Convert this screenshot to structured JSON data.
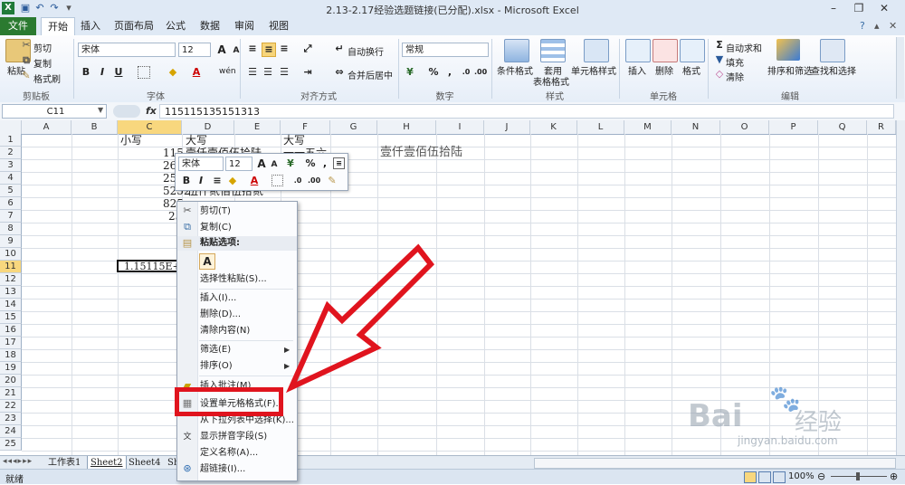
{
  "titlebar": {
    "title": "2.13-2.17经验选题链接(已分配).xlsx - Microsoft Excel",
    "window_buttons": [
      "–",
      "❐",
      "✕"
    ]
  },
  "tabs": [
    "文件",
    "开始",
    "插入",
    "页面布局",
    "公式",
    "数据",
    "审阅",
    "视图"
  ],
  "ribbon": {
    "clipboard": {
      "paste": "粘贴",
      "cut": "剪切",
      "copy": "复制",
      "format_painter": "格式刷",
      "label": "剪贴板"
    },
    "font": {
      "name": "宋体",
      "size": "12",
      "grow": "A",
      "shrink": "A",
      "bold": "B",
      "italic": "I",
      "underline": "U",
      "wen": "wén",
      "label": "字体"
    },
    "alignment": {
      "wrap": "自动换行",
      "merge": "合并后居中",
      "label": "对齐方式"
    },
    "number": {
      "format": "常规",
      "percent": "%",
      "comma": ",",
      "label": "数字"
    },
    "styles": {
      "conditional": "条件格式",
      "table_1": "套用",
      "table_2": "表格格式",
      "cell_styles": "单元格样式",
      "label": "样式"
    },
    "cells": {
      "insert": "插入",
      "delete": "删除",
      "format": "格式",
      "label": "单元格"
    },
    "editing": {
      "autosum": "自动求和",
      "fill": "填充",
      "clear": "清除",
      "sort": "排序和筛选",
      "find": "查找和选择",
      "label": "编辑"
    }
  },
  "formula_bar": {
    "name_box": "C11",
    "fx": "fx",
    "content": "115115135151313"
  },
  "grid": {
    "columns": [
      "A",
      "B",
      "C",
      "D",
      "E",
      "F",
      "G",
      "H",
      "I",
      "J",
      "K",
      "L",
      "M",
      "N",
      "O",
      "P",
      "Q",
      "R"
    ],
    "rows": [
      "1",
      "2",
      "3",
      "4",
      "5",
      "6",
      "7",
      "8",
      "9",
      "10",
      "11",
      "12",
      "13",
      "14",
      "15",
      "16",
      "17",
      "18",
      "19",
      "20",
      "21",
      "22",
      "23",
      "24",
      "25"
    ],
    "selected_column": "C",
    "selected_row": "11",
    "cells": {
      "c1": "小写",
      "d1": "大写",
      "f1": "大写",
      "c2": "115",
      "d2": "壹仟壹佰伍拾陆",
      "f2": "一一五六",
      "c3": "264",
      "c4": "252",
      "c5": "5252",
      "d5": "伍仟贰佰伍拾贰",
      "c6": "825",
      "c7": "25",
      "h2": "壹仟壹佰伍拾陆",
      "c11": "1.15115E+1"
    }
  },
  "mini_toolbar": {
    "font": "宋体",
    "size": "12",
    "grow": "A",
    "shrink": "A",
    "percent": "%",
    "comma": ",",
    "bold": "B",
    "italic": "I",
    "font_color": "A"
  },
  "context_menu": {
    "cut": "剪切(T)",
    "copy": "复制(C)",
    "paste_options": "粘贴选项:",
    "paste_icon": "A",
    "paste_special": "选择性粘贴(S)...",
    "insert": "插入(I)...",
    "delete": "删除(D)...",
    "clear": "清除内容(N)",
    "filter": "筛选(E)",
    "sort": "排序(O)",
    "insert_comment": "插入批注(M)",
    "format_cells": "设置单元格格式(F)...",
    "dropdown": "从下拉列表中选择(K)...",
    "phonetic": "显示拼音字段(S)",
    "define_name": "定义名称(A)...",
    "hyperlink": "超链接(I)..."
  },
  "sheets": [
    "工作表1",
    "Sheet2",
    "Sheet4",
    "Sh"
  ],
  "active_sheet": "Sheet2",
  "status": {
    "ready": "就绪",
    "zoom": "100%"
  },
  "watermark": {
    "brand": "Bai",
    "brand_cn": "经验",
    "url": "jingyan.baidu.com"
  },
  "colors": {
    "highlight_red": "#e0141e",
    "selection_gold": "#f8d77e",
    "file_tab": "#2b7a30"
  }
}
